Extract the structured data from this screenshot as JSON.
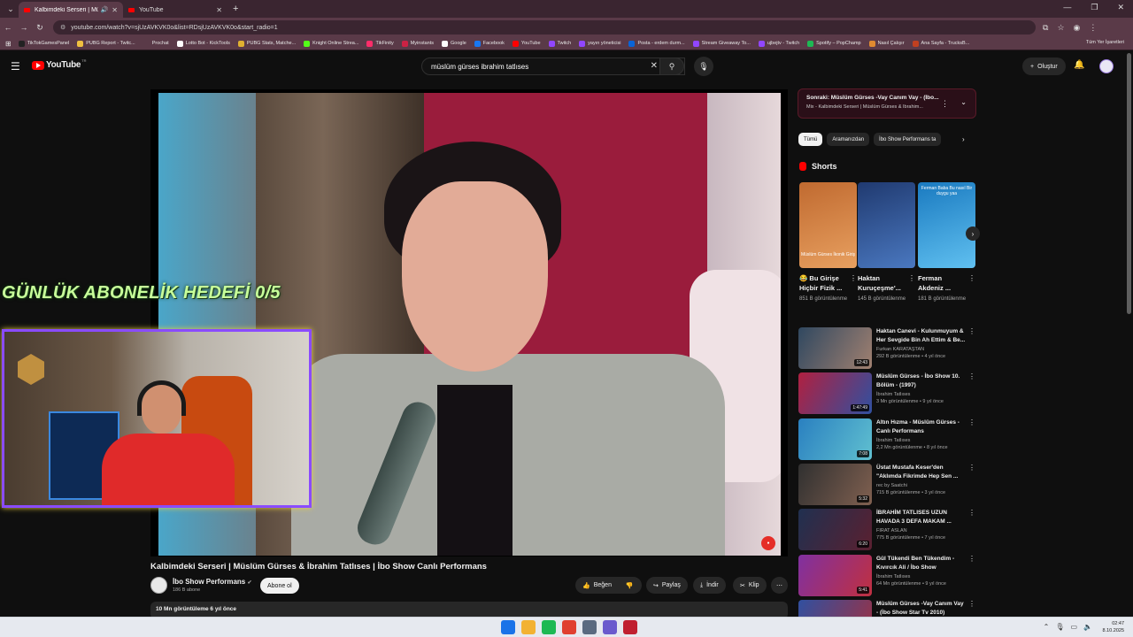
{
  "browser": {
    "tabs": [
      {
        "title": "Kalbimdeki Serseri | Müslüm",
        "active": true
      },
      {
        "title": "YouTube",
        "active": false
      }
    ],
    "url": "youtube.com/watch?v=sjUzAVKVK0o&list=RDsjUzAVKVK0o&start_radio=1",
    "bookmarks": [
      {
        "label": "TikTokGamesPanel",
        "color": "#222222"
      },
      {
        "label": "PUBG Report - Twitc...",
        "color": "#f0c040"
      },
      {
        "label": "Prochat",
        "color": "#5a3a48"
      },
      {
        "label": "Lotto Bot - KickTools",
        "color": "#ffffff"
      },
      {
        "label": "PUBG Stats, Matche...",
        "color": "#e0b030"
      },
      {
        "label": "Knight Online Strea...",
        "color": "#53fc18"
      },
      {
        "label": "TikFinity",
        "color": "#ff2d6a"
      },
      {
        "label": "Myinstants",
        "color": "#cc2244"
      },
      {
        "label": "Google",
        "color": "#ffffff"
      },
      {
        "label": "Facebook",
        "color": "#1877f2"
      },
      {
        "label": "YouTube",
        "color": "#ff0000"
      },
      {
        "label": "Twitch",
        "color": "#9146ff"
      },
      {
        "label": "yayın yöneticisi",
        "color": "#9146ff"
      },
      {
        "label": "Posta - erdem durm...",
        "color": "#0a64d8"
      },
      {
        "label": "Stream Giveaway To...",
        "color": "#9146ff"
      },
      {
        "label": "ujbejtv - Twitch",
        "color": "#9146ff"
      },
      {
        "label": "Spotify – PopChamp",
        "color": "#1db954"
      },
      {
        "label": "Nasıl Çalışır",
        "color": "#e08a30"
      },
      {
        "label": "Ana Sayfa - TrucksB...",
        "color": "#c04020"
      }
    ],
    "all_bookmarks_label": "Tüm Yer İşaretleri"
  },
  "header": {
    "logo_text": "YouTube",
    "region": "TR",
    "search_value": "müslüm gürses ibrahim tatlıses",
    "create_label": "Oluştur"
  },
  "overlay": {
    "goal_text": "GÜNLÜK ABONELİK HEDEFİ  0/5"
  },
  "video": {
    "title": "Kalbimdeki Serseri | Müslüm Gürses & İbrahim Tatlıses | İbo Show Canlı Performans",
    "channel": "İbo Show Performans",
    "subscribers": "186 B abone",
    "subscribe_label": "Abone ol",
    "like_label": "Beğen",
    "share_label": "Paylaş",
    "download_label": "İndir",
    "clip_label": "Klip",
    "description_meta": "10 Mn görüntüleme  6 yıl önce"
  },
  "sidebar": {
    "up_next": {
      "line1": "Sonraki: Müslüm Gürses -Vay Canım Vay - (İbo...",
      "line2": "Mix - Kalbimdeki Serseri | Müslüm Gürses & İbrahim..."
    },
    "chips": [
      "Tümü",
      "Aramanızdan",
      "İbo Show Performans ta"
    ],
    "shorts_title": "Shorts",
    "shorts": [
      {
        "title": "😂 Bu Girişe Hiçbir Fizik ...",
        "views": "851 B görüntülenme",
        "thumb_text": "Müslüm Gürses İkonik Giriş",
        "colors": [
          "#c06a30",
          "#e8a060"
        ]
      },
      {
        "title": "Haktan Kuruçeşme'...",
        "views": "145 B görüntülenme",
        "thumb_text": "",
        "colors": [
          "#203a70",
          "#4a78c0"
        ]
      },
      {
        "title": "Ferman Akdeniz ...",
        "views": "181 B görüntülenme",
        "thumb_text": "Ferman Baba Bu nasıl Bir duygu yaa",
        "colors": [
          "#1a7ac0",
          "#60c0f0"
        ]
      }
    ],
    "recommendations": [
      {
        "title": "Haktan Canevi - Kulunmuyum & Her Sevgide Bin Ah Ettim & Be...",
        "channel": "Furkan KARATAŞTAN",
        "meta": "292 B görüntülenme • 4 yıl önce",
        "duration": "12:43",
        "colors": [
          "#304860",
          "#a08070"
        ]
      },
      {
        "title": "Müslüm Gürses - İbo Show 10. Bölüm - (1997)",
        "channel": "İbrahim Tatlıses",
        "meta": "3 Mn görüntülenme • 9 yıl önce",
        "duration": "1:47:49",
        "colors": [
          "#b02040",
          "#3050a0"
        ]
      },
      {
        "title": "Altın Hızma - Müslüm Gürses - Canlı Performans",
        "channel": "İbrahim Tatlıses",
        "meta": "2,2 Mn görüntülenme • 8 yıl önce",
        "duration": "7:08",
        "colors": [
          "#2a80c0",
          "#60c0d0"
        ]
      },
      {
        "title": "Üstat Mustafa Keser'den \"Aklımda Fikrimde Hep Sen ...",
        "channel": "rec by Saatchi",
        "meta": "715 B görüntülenme • 3 yıl önce",
        "duration": "5:32",
        "colors": [
          "#303030",
          "#806050"
        ]
      },
      {
        "title": "İBRAHİM TATLISES UZUN HAVADA 3 DEFA MAKAM ...",
        "channel": "FIRAT ASLAN",
        "meta": "775 B görüntülenme • 7 yıl önce",
        "duration": "6:20",
        "colors": [
          "#203050",
          "#5a2030"
        ]
      },
      {
        "title": "Gül Tükendi Ben Tükendim - Kıvırcık Ali / İbo Show",
        "channel": "İbrahim Tatlıses",
        "meta": "64 Mn görüntülenme • 9 yıl önce",
        "duration": "5:41",
        "colors": [
          "#8030a0",
          "#c03040"
        ]
      },
      {
        "title": "Müslüm Gürses -Vay Canım Vay - (İbo Show Star Tv 2010)",
        "channel": "",
        "meta": "",
        "duration": "",
        "colors": [
          "#3050a0",
          "#a03040"
        ]
      }
    ]
  },
  "taskbar": {
    "time": "02:47",
    "date": "8.10.2025",
    "app_colors": [
      "#1a73e8",
      "#f2b233",
      "#1db954",
      "#e04030",
      "#5a6a80",
      "#6a5acd",
      "#c02030"
    ]
  }
}
